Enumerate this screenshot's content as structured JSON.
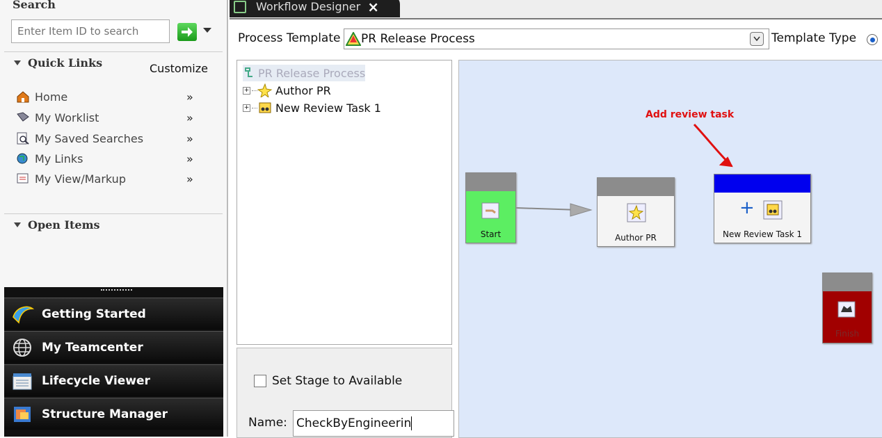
{
  "search": {
    "heading": "Search",
    "placeholder": "Enter Item ID to search"
  },
  "quick_links": {
    "heading": "Quick Links",
    "customize_label": "Customize",
    "items": [
      {
        "label": "Home",
        "icon": "home-icon",
        "chevron": "»"
      },
      {
        "label": "My Worklist",
        "icon": "worklist-icon",
        "chevron": "»"
      },
      {
        "label": "My Saved Searches",
        "icon": "saved-search-icon",
        "chevron": "»"
      },
      {
        "label": "My Links",
        "icon": "links-icon",
        "chevron": "»"
      },
      {
        "label": "My View/Markup",
        "icon": "markup-icon",
        "chevron": "»"
      }
    ]
  },
  "open_items": {
    "heading": "Open Items"
  },
  "nav_buttons": [
    {
      "label": "Getting Started",
      "icon": "getting-started-icon"
    },
    {
      "label": "My Teamcenter",
      "icon": "globe-icon"
    },
    {
      "label": "Lifecycle Viewer",
      "icon": "lifecycle-viewer-icon"
    },
    {
      "label": "Structure Manager",
      "icon": "structure-manager-icon"
    }
  ],
  "designer": {
    "tab_label": "Workflow Designer",
    "tab_close": "×",
    "process_template_label": "Process Template",
    "process_template_value": "PR Release Process",
    "template_type_label": "Template Type",
    "tree": {
      "root": "PR Release Process",
      "children": [
        "Author PR",
        "New Review Task 1"
      ]
    },
    "set_stage_label": "Set Stage to Available",
    "name_label": "Name:",
    "name_value": "CheckByEngineerin"
  },
  "canvas": {
    "annotation": "Add review task",
    "annotation_color": "#e01010",
    "nodes": {
      "start": "Start",
      "author": "Author PR",
      "review": "New Review Task 1",
      "finish": "Finish"
    },
    "add_glyph": "+"
  },
  "colors": {
    "canvas_bg": "#dde8fa",
    "start_green": "#5cee62",
    "review_header": "#0000ee",
    "finish_red": "#a10000",
    "dark_nav": "#111111"
  }
}
